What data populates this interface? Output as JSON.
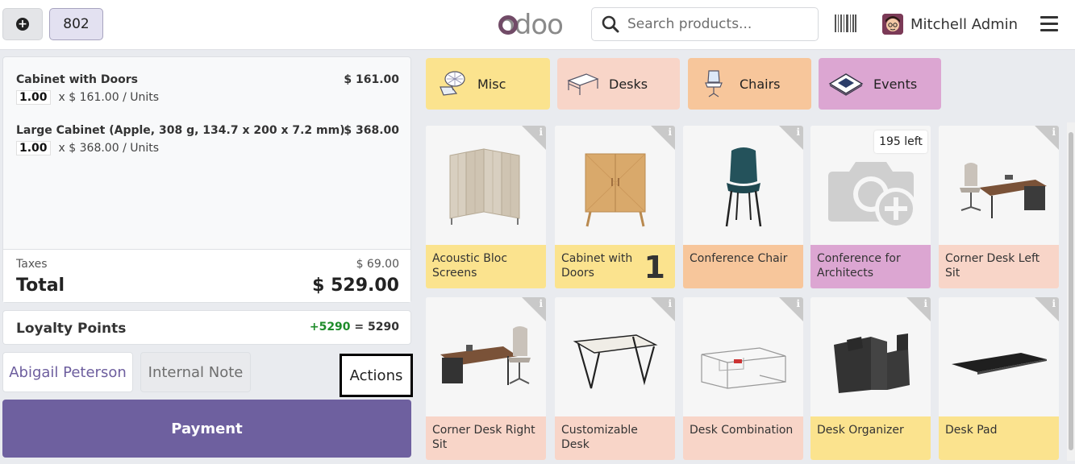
{
  "header": {
    "order_number": "802",
    "logo_text": "odoo",
    "search_placeholder": "Search products...",
    "user_name": "Mitchell Admin",
    "icons": [
      "plus-circle-icon",
      "search-icon",
      "barcode-icon",
      "user-avatar",
      "hamburger-menu-icon"
    ]
  },
  "orderlines": [
    {
      "name": "Cabinet with Doors",
      "price": "$ 161.00",
      "qty": "1.00",
      "unit_text": "x $ 161.00 / Units"
    },
    {
      "name": "Large Cabinet (Apple, 308 g, 134.7 x 200 x 7.2 mm)",
      "price": "$ 368.00",
      "qty": "1.00",
      "unit_text": "x $ 368.00 / Units"
    }
  ],
  "summary": {
    "taxes_label": "Taxes",
    "taxes_value": "$ 69.00",
    "total_label": "Total",
    "total_value": "$ 529.00"
  },
  "loyalty": {
    "label": "Loyalty Points",
    "gain": "+5290",
    "equals": "=",
    "total": "5290"
  },
  "controls": {
    "customer": "Abigail Peterson",
    "internal_note": "Internal Note",
    "actions": "Actions",
    "payment": "Payment"
  },
  "categories": [
    {
      "label": "Misc",
      "color": "#fbe38e",
      "icon": "misc-icon"
    },
    {
      "label": "Desks",
      "color": "#f8d5c8",
      "icon": "desk-icon"
    },
    {
      "label": "Chairs",
      "color": "#f7c69b",
      "icon": "chair-icon"
    },
    {
      "label": "Events",
      "color": "#dca6d2",
      "icon": "ticket-icon"
    }
  ],
  "products": [
    {
      "name": "Acoustic Bloc Screens",
      "color": "#fbe38e"
    },
    {
      "name": "Cabinet with Doors",
      "color": "#fbe38e",
      "qty": "1"
    },
    {
      "name": "Conference Chair",
      "color": "#f7c69b"
    },
    {
      "name": "Conference for Architects",
      "color": "#dca6d2",
      "stock": "195 left"
    },
    {
      "name": "Corner Desk Left Sit",
      "color": "#f8d5c8"
    },
    {
      "name": "Corner Desk Right Sit",
      "color": "#f8d5c8"
    },
    {
      "name": "Customizable Desk",
      "color": "#f8d5c8"
    },
    {
      "name": "Desk Combination",
      "color": "#f8d5c8"
    },
    {
      "name": "Desk Organizer",
      "color": "#fbe38e"
    },
    {
      "name": "Desk Pad",
      "color": "#fbe38e"
    }
  ]
}
